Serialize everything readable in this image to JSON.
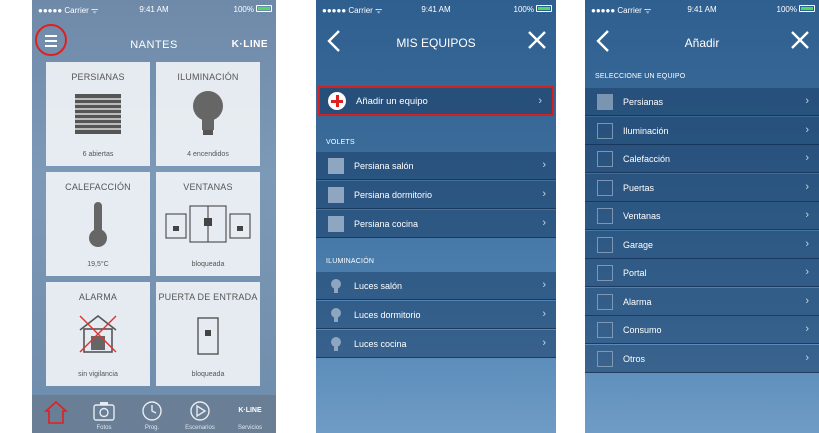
{
  "status": {
    "carrier": "●●●●● Carrier ᯤ",
    "time": "9:41 AM",
    "battery": "100%"
  },
  "home": {
    "title": "NANTES",
    "brand": "K·LINE",
    "tiles": [
      {
        "title": "PERSIANAS",
        "sub": "6 abiertas",
        "icon": "shutter-icon"
      },
      {
        "title": "ILUMINACIÓN",
        "sub": "4 encendidos",
        "icon": "bulb-icon"
      },
      {
        "title": "CALEFACCIÓN",
        "sub": "19,5°C",
        "icon": "thermometer-icon"
      },
      {
        "title": "VENTANAS",
        "sub": "bloqueada",
        "icon": "window-icon"
      },
      {
        "title": "ALARMA",
        "sub": "sin vigilancia",
        "icon": "alarm-house-icon"
      },
      {
        "title": "PUERTA DE ENTRADA",
        "sub": "bloqueada",
        "icon": "door-icon"
      }
    ],
    "tabs": [
      {
        "label": "",
        "icon": "home-icon"
      },
      {
        "label": "Fotos",
        "icon": "camera-icon"
      },
      {
        "label": "Prog.",
        "icon": "clock-icon"
      },
      {
        "label": "Escenarios",
        "icon": "play-icon"
      },
      {
        "label": "Servicios",
        "icon": "kline-icon",
        "brand": "K·LINE"
      }
    ]
  },
  "equipos": {
    "title": "MIS EQUIPOS",
    "add_label": "Añadir un equipo",
    "sections": [
      {
        "header": "VOLETS",
        "items": [
          "Persiana salón",
          "Persiana dormitorio",
          "Persiana cocina"
        ]
      },
      {
        "header": "ILUMINACIÓN",
        "items": [
          "Luces salón",
          "Luces dormitorio",
          "Luces cocina"
        ]
      }
    ]
  },
  "anadir": {
    "title": "Añadir",
    "section": "SELECCIONE UN EQUIPO",
    "items": [
      "Persianas",
      "Iluminación",
      "Calefacción",
      "Puertas",
      "Ventanas",
      "Garage",
      "Portal",
      "Alarma",
      "Consumo",
      "Otros"
    ],
    "icons": [
      "shutter-icon",
      "bulb-icon",
      "thermometer-icon",
      "door-icon",
      "window-icon",
      "garage-icon",
      "gate-icon",
      "alarm-icon",
      "consumption-chart-icon",
      "more-icon"
    ]
  }
}
